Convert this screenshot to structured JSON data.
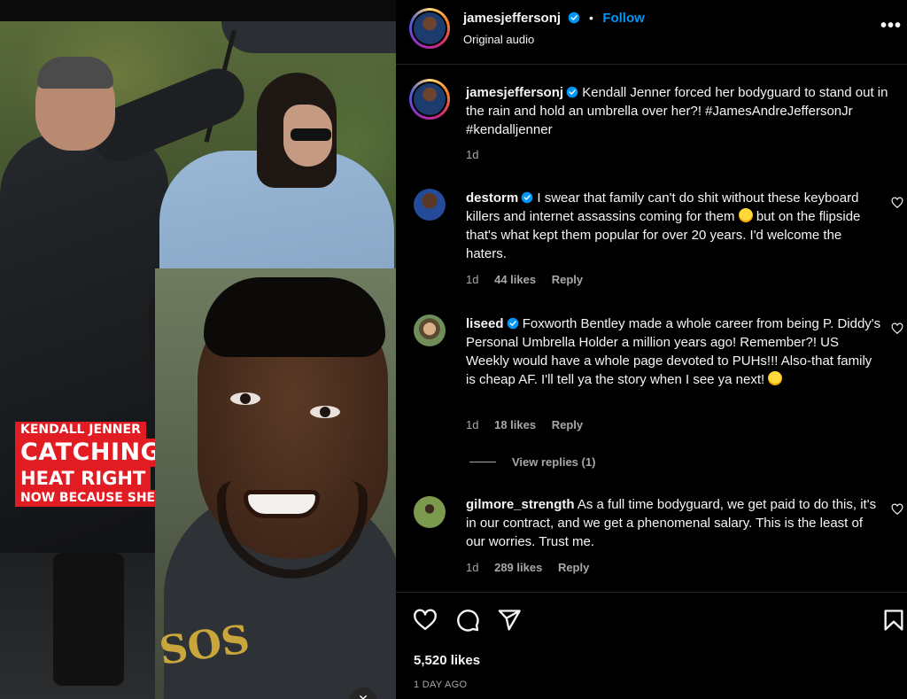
{
  "media": {
    "caption_lines": [
      "KENDALL JENNER",
      "CATCHING",
      "HEAT RIGHT",
      "NOW BECAUSE SHE"
    ],
    "sweatshirt_print": "SOS"
  },
  "header": {
    "username": "jamesjeffersonj",
    "separator": "•",
    "follow_label": "Follow",
    "audio": "Original audio",
    "more": "•••"
  },
  "post_caption": {
    "username": "jamesjeffersonj",
    "text": "Kendall Jenner forced her bodyguard to stand out in the rain and hold an umbrella over her?! #JamesAndreJeffersonJr #kendalljenner",
    "time": "1d"
  },
  "comments": [
    {
      "username": "destorm",
      "text_before": "I swear that family can't do shit without these keyboard killers and internet assassins coming for them",
      "text_after": "but on the flipside that's what kept them popular for over 20 years. I'd welcome the haters.",
      "time": "1d",
      "likes": "44 likes",
      "reply": "Reply"
    },
    {
      "username": "liseed",
      "text_before": "Foxworth Bentley made a whole career from being P. Diddy's Personal Umbrella Holder a million years ago! Remember?! US Weekly would have a whole page devoted to PUHs!!! Also-that family is cheap AF. I'll tell ya the story when I see ya next!",
      "text_after": "",
      "time": "1d",
      "likes": "18 likes",
      "reply": "Reply",
      "view_replies": "View replies (1)"
    },
    {
      "username": "gilmore_strength",
      "text_before": "As a full time bodyguard, we get paid to do this, it's in our contract, and we get a phenomenal salary. This is the least of our worries. Trust me.",
      "text_after": "",
      "time": "1d",
      "likes": "289 likes",
      "reply": "Reply"
    }
  ],
  "footer": {
    "likes": "5,520 likes",
    "time_ago": "1 DAY AGO"
  },
  "icons": {
    "like": "heart-icon",
    "comment": "comment-icon",
    "share": "share-icon",
    "save": "bookmark-icon",
    "mute": "speaker-muted-icon"
  },
  "colors": {
    "link_blue": "#0095f6",
    "caption_red": "#e21c23",
    "muted_text": "#a8a8a8"
  }
}
